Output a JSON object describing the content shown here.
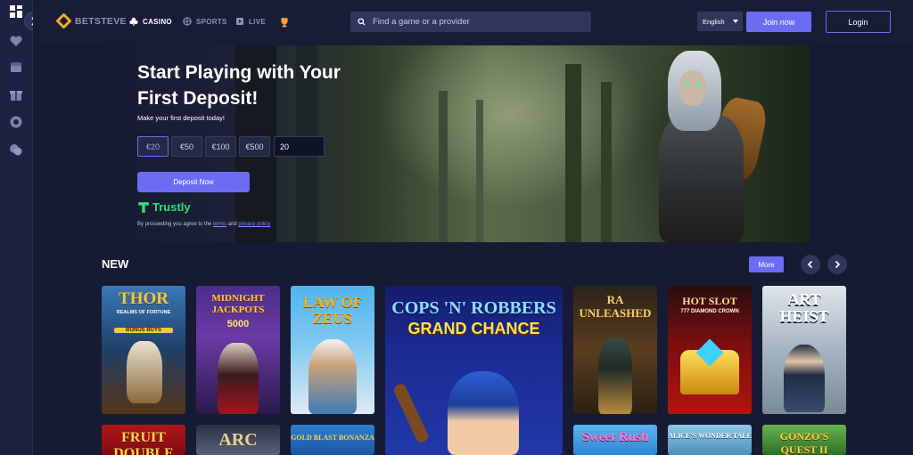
{
  "brand": {
    "name": "BETSTEVE",
    "accent": "#6c6cf2",
    "logo_color": "#f2a72d"
  },
  "nav": [
    {
      "label": "CASINO",
      "icon": "club-icon",
      "active": true
    },
    {
      "label": "SPORTS",
      "icon": "ball-icon",
      "active": false
    },
    {
      "label": "LIVE",
      "icon": "tv-icon",
      "active": false
    },
    {
      "label": "",
      "icon": "trophy-icon",
      "active": false
    }
  ],
  "search": {
    "placeholder": "Find a game or a provider"
  },
  "language": {
    "selected": "English"
  },
  "auth": {
    "join_label": "Join now",
    "login_label": "Login"
  },
  "hero": {
    "title": "Start Playing with Your First Deposit!",
    "subtitle": "Make your first deposit today!",
    "amounts": [
      "€20",
      "€50",
      "€100",
      "€500"
    ],
    "selected_amount": "€20",
    "amount_value": "20",
    "deposit_label": "Deposit Now",
    "payment_provider": "Trustly",
    "terms_prefix": "By proceeding you agree to the",
    "terms_link": "terms",
    "terms_and": "and",
    "privacy_link": "privacy policy"
  },
  "new_section": {
    "title": "NEW",
    "more_label": "More",
    "games_row1": [
      {
        "title": "THOR",
        "subtitle": "REALMS OF FORTUNE",
        "badge": "BONUS BUYS"
      },
      {
        "title": "MIDNIGHT JACKPOTS",
        "subtitle": "5000"
      },
      {
        "title": "LAW OF ZEUS",
        "subtitle": ""
      },
      {
        "title": "COPS 'N' ROBBERS",
        "subtitle": "GRAND CHANCE"
      },
      {
        "title": "RA UNLEASHED",
        "subtitle": ""
      },
      {
        "title": "HOT SLOT",
        "subtitle": "777 DIAMOND CROWN"
      },
      {
        "title": "ART HEIST",
        "subtitle": ""
      }
    ],
    "games_row2": [
      {
        "title": "FRUIT DOUBLE"
      },
      {
        "title": "ARC"
      },
      {
        "title": "GOLD BLAST BONANZA"
      },
      {
        "title": "Sweet Rush"
      },
      {
        "title": "ALICE'S WONDER TALE"
      },
      {
        "title": "GONZO'S QUEST II"
      }
    ]
  }
}
